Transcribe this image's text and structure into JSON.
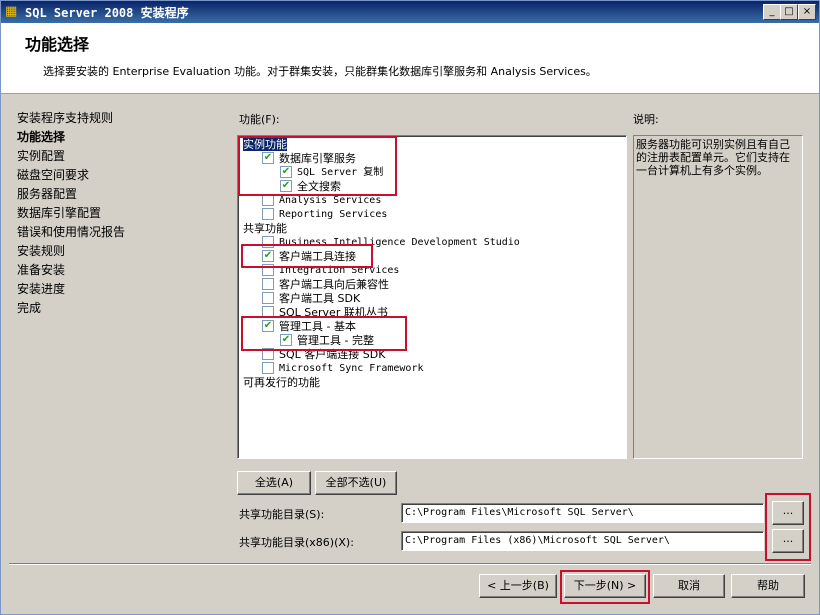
{
  "window": {
    "title": "SQL Server 2008 安装程序",
    "minimize": "_",
    "maximize": "□",
    "close": "×"
  },
  "header": {
    "title": "功能选择",
    "description": "选择要安装的 Enterprise  Evaluation 功能。对于群集安装，只能群集化数据库引擎服务和 Analysis Services。"
  },
  "nav": {
    "items": [
      "安装程序支持规则",
      "功能选择",
      "实例配置",
      "磁盘空间要求",
      "服务器配置",
      "数据库引擎配置",
      "错误和使用情况报告",
      "安装规则",
      "准备安装",
      "安装进度",
      "完成"
    ],
    "active_index": 1
  },
  "features": {
    "label": "功能(F):",
    "group_instance": "实例功能",
    "db_engine": {
      "label": "数据库引擎服务",
      "checked": true
    },
    "sql_replication": {
      "label": "SQL Server 复制",
      "checked": true
    },
    "full_text": {
      "label": "全文搜索",
      "checked": true
    },
    "analysis": {
      "label": "Analysis Services",
      "checked": false
    },
    "reporting": {
      "label": "Reporting Services",
      "checked": false
    },
    "group_shared": "共享功能",
    "bids": {
      "label": "Business Intelligence Development Studio",
      "checked": false
    },
    "client_conn": {
      "label": "客户端工具连接",
      "checked": true
    },
    "integration": {
      "label": "Integration Services",
      "checked": false
    },
    "client_compat": {
      "label": "客户端工具向后兼容性",
      "checked": false
    },
    "client_sdk": {
      "label": "客户端工具 SDK",
      "checked": false
    },
    "books_online": {
      "label": "SQL Server 联机丛书",
      "checked": false
    },
    "mgmt_basic": {
      "label": "管理工具 - 基本",
      "checked": true
    },
    "mgmt_complete": {
      "label": "管理工具 - 完整",
      "checked": true
    },
    "client_conn_sdk": {
      "label": "SQL 客户端连接 SDK",
      "checked": false
    },
    "sync_framework": {
      "label": "Microsoft Sync Framework",
      "checked": false
    },
    "group_redist": "可再发行的功能"
  },
  "description": {
    "label": "说明:",
    "text": "服务器功能可识别实例且有自己的注册表配置单元。它们支持在一台计算机上有多个实例。"
  },
  "buttons": {
    "select_all": "全选(A)",
    "unselect_all": "全部不选(U)",
    "browse": "...",
    "back": "< 上一步(B)",
    "next": "下一步(N) >",
    "cancel": "取消",
    "help": "帮助"
  },
  "shared_dir": {
    "label": "共享功能目录(S):",
    "value": "C:\\Program Files\\Microsoft SQL Server\\"
  },
  "shared_dir_x86": {
    "label": "共享功能目录(x86)(X):",
    "value": "C:\\Program Files (x86)\\Microsoft SQL Server\\"
  },
  "colors": {
    "highlight": "#c8102e",
    "title_bar": "#0a246a",
    "check": "#21a121"
  }
}
